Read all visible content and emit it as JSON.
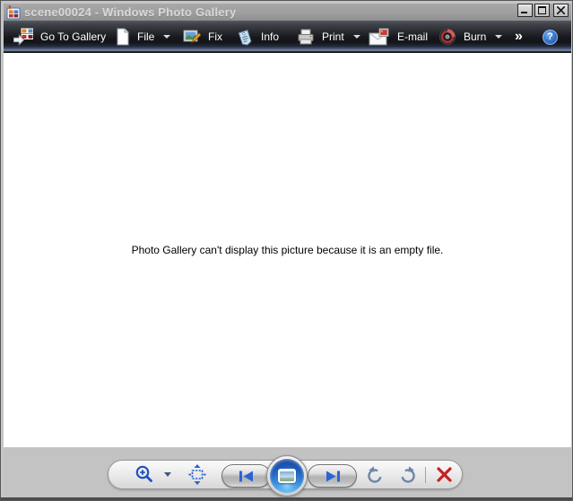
{
  "window": {
    "title": "scene00024 - Windows Photo Gallery",
    "app_icon": "photo-gallery-app-icon"
  },
  "titlebar": {
    "buttons": [
      "minimize",
      "maximize",
      "close"
    ]
  },
  "toolbar": {
    "items": [
      {
        "label": "Go To Gallery",
        "icon": "go-to-gallery-icon",
        "dropdown": false
      },
      {
        "label": "File",
        "icon": "file-page-icon",
        "dropdown": true
      },
      {
        "label": "Fix",
        "icon": "fix-photo-pencil-icon",
        "dropdown": false
      },
      {
        "label": "Info",
        "icon": "info-tag-icon",
        "dropdown": false
      },
      {
        "label": "Print",
        "icon": "printer-icon",
        "dropdown": true
      },
      {
        "label": "E-mail",
        "icon": "email-envelope-icon",
        "dropdown": false
      },
      {
        "label": "Burn",
        "icon": "burn-disc-icon",
        "dropdown": true
      }
    ],
    "overflow": "»",
    "help_glyph": "?"
  },
  "content": {
    "message": "Photo Gallery can't display this picture because it is an empty file."
  },
  "playback_bar": {
    "controls": [
      "zoom",
      "fit-to-window",
      "previous",
      "slideshow",
      "next",
      "rotate-counterclockwise",
      "rotate-clockwise",
      "delete"
    ]
  },
  "colors": {
    "titlebar_gray": "#9e9e9e",
    "toolbar_dark": "#17181d",
    "toolbar_blue_band": "#8a94ac",
    "bottom_bar_gray": "#c3c3c3",
    "control_blue": "#2a65d4",
    "rotate_blue_gray": "#6e87a8",
    "delete_red": "#c82020",
    "help_blue": "#2f6fc4"
  }
}
